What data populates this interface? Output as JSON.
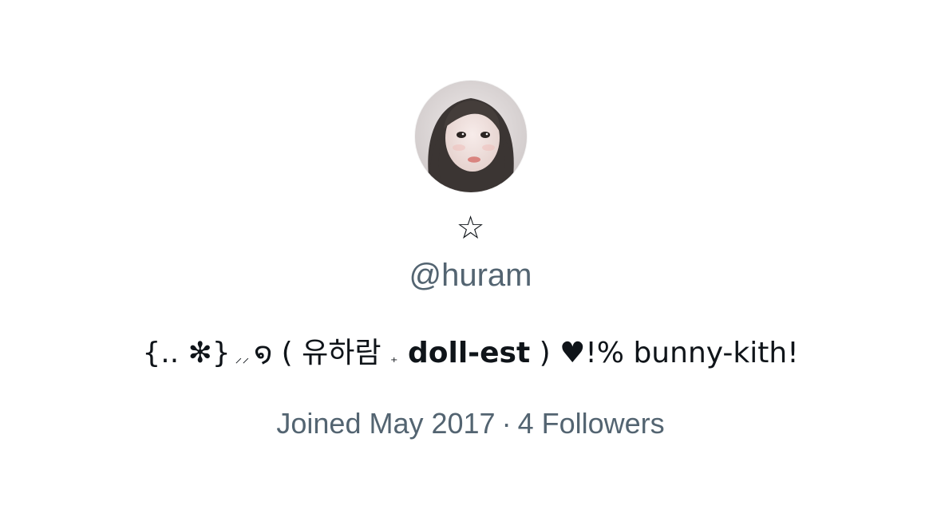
{
  "profile": {
    "display_name": "☆",
    "handle": "@huram",
    "bio": {
      "part1": "{.. ✻}",
      "part2": " ⸝⸝ ",
      "part3": "໑ ( 유하람 ",
      "part4": "₊",
      "part5": " doll-est",
      "part6": " ) ♥!% bunny-kith!"
    },
    "joined": "Joined May 2017",
    "separator": "·",
    "followers": "4 Followers"
  },
  "colors": {
    "text_primary": "#0f1419",
    "text_secondary": "#536471",
    "background": "#ffffff"
  }
}
